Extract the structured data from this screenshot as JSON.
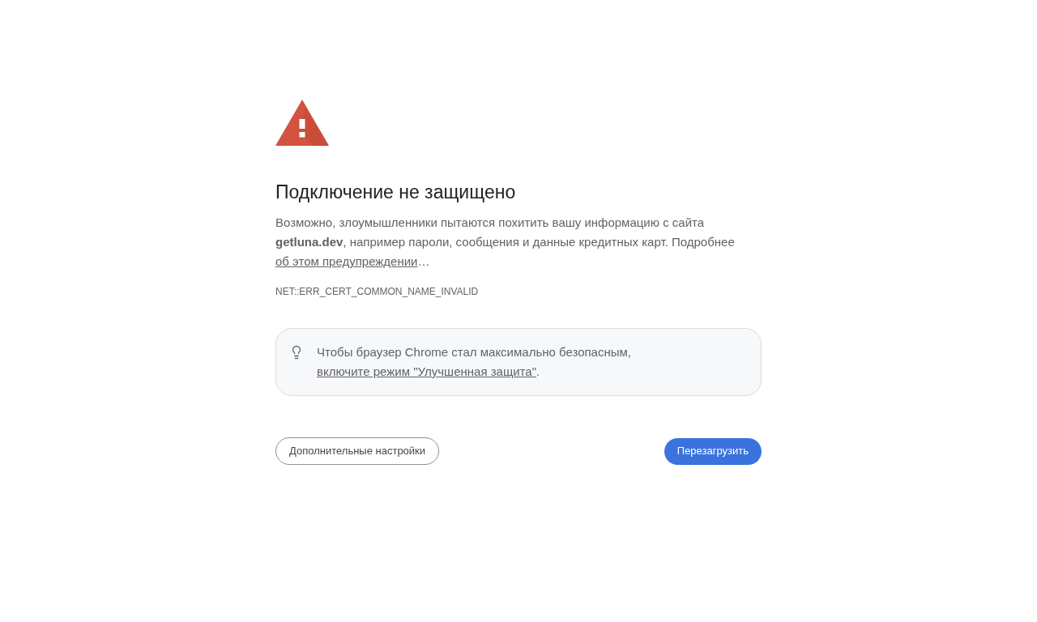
{
  "heading": "Подключение не защищено",
  "description": {
    "text": "Возможно, злоумышленники пытаются похитить вашу информацию с сайта **getluna.dev**, например пароли, сообщения и данные кредитных карт. Подробнее",
    "link": "об этом предупреждении",
    "suffix": "…"
  },
  "error_code": "NET::ERR_CERT_COMMON_NAME_INVALID",
  "tip": {
    "text": "Чтобы браузер Chrome стал максимально безопасным,",
    "link": "включите режим \"Улучшенная защита\"",
    "suffix": "."
  },
  "buttons": [
    {
      "label": "Дополнительные настройки",
      "kind": "secondary"
    },
    {
      "label": "Перезагрузить",
      "kind": "primary"
    }
  ]
}
